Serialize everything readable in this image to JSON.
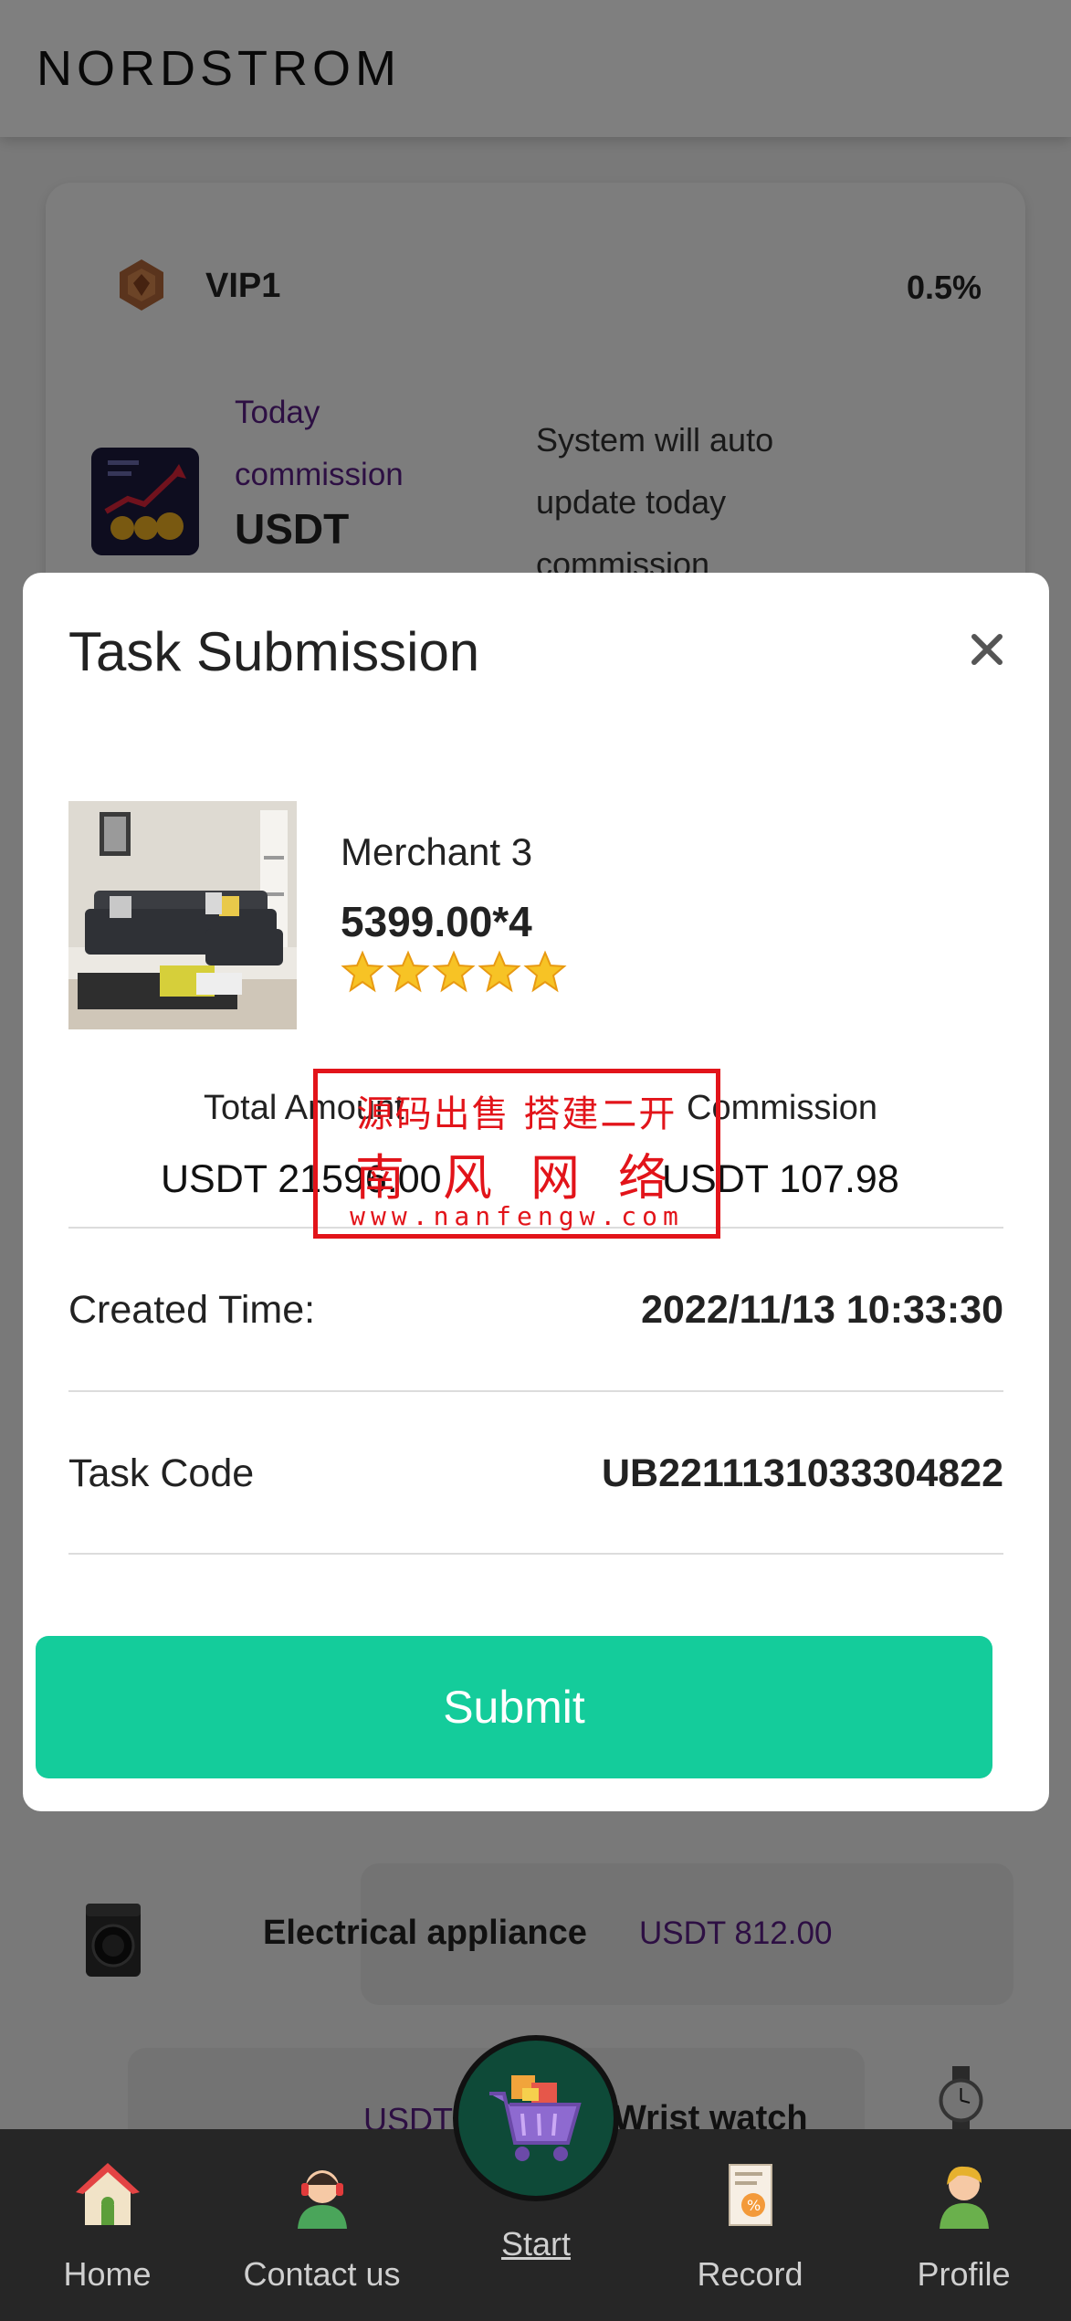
{
  "header": {
    "logo": "NORDSTROM"
  },
  "vip": {
    "level": "VIP1",
    "rate": "0.5%",
    "commission_label": "Today commission",
    "commission_currency": "USDT",
    "note": "System will auto update today commission"
  },
  "products": {
    "appliance": {
      "name": "Electrical appliance",
      "price": "USDT 812.00"
    },
    "watch": {
      "price": "USDT",
      "name": "Wrist watch"
    }
  },
  "modal": {
    "title": "Task Submission",
    "merchant": "Merchant 3",
    "price_qty": "5399.00*4",
    "rating_stars": 5,
    "total_amount_label": "Total Amount",
    "total_amount_value": "USDT 21596.00",
    "commission_label": "Commission",
    "commission_value": "USDT 107.98",
    "created_time_label": "Created Time:",
    "created_time_value": "2022/11/13 10:33:30",
    "task_code_label": "Task Code",
    "task_code_value": "UB2211131033304822",
    "submit_label": "Submit"
  },
  "watermark": {
    "line1": "源码出售 搭建二开",
    "line2": "南风网络",
    "line3": "www.nanfengw.com"
  },
  "nav": {
    "home": "Home",
    "contact": "Contact us",
    "start": "Start",
    "record": "Record",
    "profile": "Profile"
  },
  "colors": {
    "accent": "#14cc9b",
    "purple": "#5a1f86",
    "nav_bg": "#262626",
    "stamp_red": "#e2141a"
  }
}
